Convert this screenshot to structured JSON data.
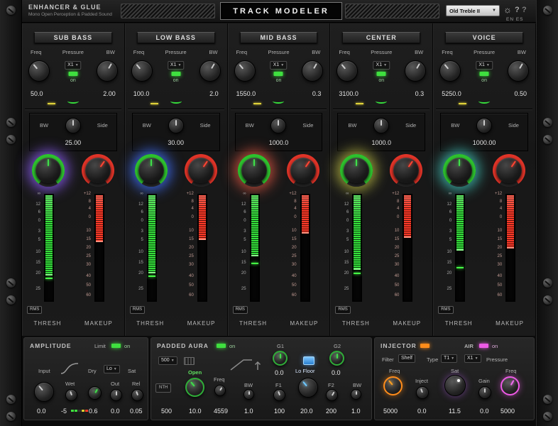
{
  "header": {
    "brand": "ENHANCER & GLUE",
    "tagline": "Mono Open Perception & Padded Sound",
    "title": "TRACK MODELER",
    "preset": "Old Treble II",
    "gear_icon": "☼",
    "help_icon": "?",
    "lang": "EN ES"
  },
  "band_labels": {
    "freq": "Freq",
    "pressure": "Pressure",
    "bw": "BW",
    "on": "on",
    "side": "Side",
    "thresh": "THRESH",
    "makeup": "MAKEUP",
    "rms": "RMS"
  },
  "meter_scales": {
    "thresh": [
      "∞",
      "12",
      "6",
      "0",
      "3",
      "5",
      "10",
      "15",
      "20",
      "25"
    ],
    "makeup": [
      "+12",
      "8",
      "4",
      "0",
      "10",
      "15",
      "20",
      "25",
      "30",
      "40",
      "50",
      "60"
    ]
  },
  "bands": [
    {
      "name": "SUB BASS",
      "pressure_mode": "X1",
      "freq_value": "50.0",
      "bw_value": "2.00",
      "side_bw_value": "25.00",
      "glow_color": "#7b52d6",
      "thresh_meter_fill": 0.75,
      "makeup_meter_fill": 0.44,
      "thresh_peak": 0.78
    },
    {
      "name": "LOW BASS",
      "pressure_mode": "X1",
      "freq_value": "100.0",
      "bw_value": "2.0",
      "side_bw_value": "30.00",
      "glow_color": "#3a62d8",
      "thresh_meter_fill": 0.73,
      "makeup_meter_fill": 0.42,
      "thresh_peak": 0.76
    },
    {
      "name": "MID BASS",
      "pressure_mode": "X1",
      "freq_value": "1550.0",
      "bw_value": "0.3",
      "side_bw_value": "1000.0",
      "glow_color": "#b84a3a",
      "thresh_meter_fill": 0.57,
      "makeup_meter_fill": 0.36,
      "thresh_peak": 0.64
    },
    {
      "name": "CENTER",
      "pressure_mode": "X1",
      "freq_value": "3100.0",
      "bw_value": "0.3",
      "side_bw_value": "1000.0",
      "glow_color": "#9a9a3a",
      "thresh_meter_fill": 0.7,
      "makeup_meter_fill": 0.4,
      "thresh_peak": 0.73
    },
    {
      "name": "VOICE",
      "pressure_mode": "X1",
      "freq_value": "5250.0",
      "bw_value": "0.50",
      "side_bw_value": "1000.00",
      "glow_color": "#3aa8a0",
      "thresh_meter_fill": 0.52,
      "makeup_meter_fill": 0.5,
      "thresh_peak": 0.68
    }
  ],
  "amplitude": {
    "title": "AMPLITUDE",
    "limit": "Limit",
    "on": "on",
    "input": "Input",
    "dry": "Dry",
    "sat": "Sat",
    "sat_mode": "Lo",
    "wet": "Wet",
    "out": "Out",
    "rel": "Rel",
    "input_value": "0.0",
    "wet_value": "-5",
    "dry_value": "0.6",
    "out_value": "0.0",
    "rel_value": "0.05"
  },
  "aura": {
    "title": "PADDED AURA",
    "on": "on",
    "rate": "500",
    "nth": "NTH",
    "open": "Open",
    "freq": "Freq",
    "bw1": "BW",
    "g1": "G1",
    "f1": "F1",
    "lo_floor": "Lo Floor",
    "g2": "G2",
    "f2": "F2",
    "bw2": "BW",
    "nth_value": "500",
    "open_value": "10.0",
    "freq_value": "4559",
    "bw1_value": "1.0",
    "g1_value": "0.0",
    "f1_value": "100",
    "lo_floor_value": "20.0",
    "g2_value": "0.0",
    "f2_value": "200",
    "bw2_value": "1.0"
  },
  "injector": {
    "title": "INJECTOR",
    "air": "AIR",
    "on": "on",
    "filter": "Filter",
    "filter_type": "Shelf",
    "type": "Type",
    "type_value": "T1",
    "pressure_mode": "X1",
    "pressure": "Pressure",
    "freq1": "Freq",
    "inject": "Inject",
    "sat": "Sat",
    "gain": "Gain",
    "freq2": "Freq",
    "freq1_value": "5000",
    "inject_value": "0.0",
    "sat_value": "11.5",
    "gain_value": "0.0",
    "freq2_value": "5000"
  },
  "colors": {
    "green": "#3fe03f",
    "red": "#ff3a28",
    "orange": "#ff8c1a",
    "magenta": "#ee5ae6",
    "blue": "#35a6e0"
  }
}
